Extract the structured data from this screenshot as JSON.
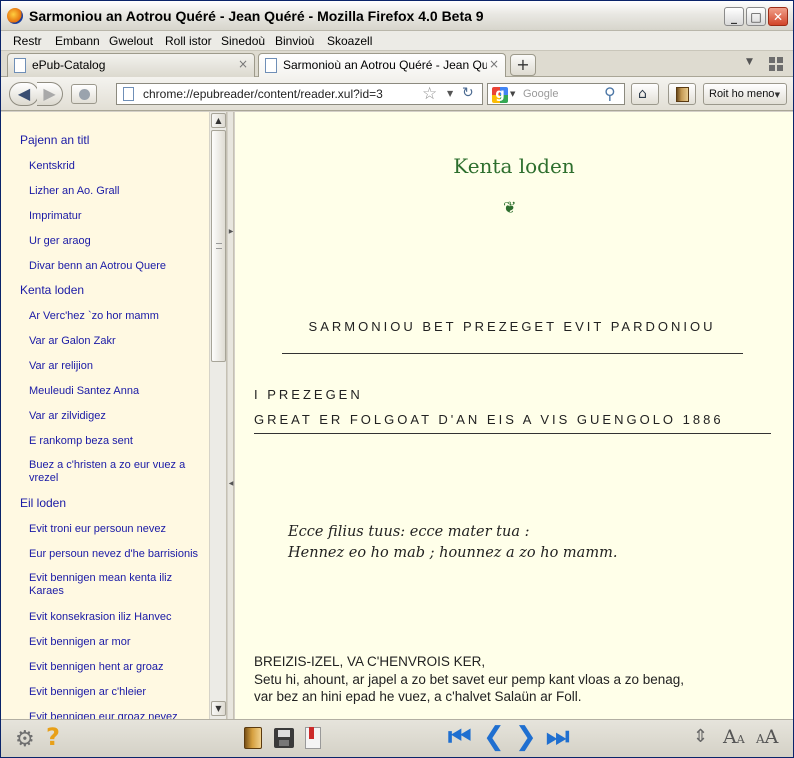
{
  "window": {
    "title": "Sarmoniou an Aotrou Quéré - Jean Quéré - Mozilla Firefox 4.0 Beta 9",
    "minimize": "_",
    "maximize": "□",
    "close": "✕"
  },
  "menu": [
    "Restr",
    "Embann",
    "Gwelout",
    "Roll istor",
    "Sinedoù",
    "Binvioù",
    "Skoazell"
  ],
  "tabs": [
    {
      "label": "ePub-Catalog",
      "close": "×"
    },
    {
      "label": "Sarmonioù an Aotrou Quéré - Jean Quéré",
      "close": "×"
    }
  ],
  "newtab": "+",
  "tablist": "▼",
  "nav": {
    "back": "◀",
    "forward": "▶",
    "url": "chrome://epubreader/content/reader.xul?id=3",
    "star": "☆",
    "url_dropdown": "▼",
    "reload": "↻",
    "search_engine_dropdown": "▼",
    "search_placeholder": "Google",
    "search_icon": "⚲",
    "home": "⌂",
    "reader_mode": "Roit ho meno",
    "reader_mode_dropdown": "▼"
  },
  "toc": [
    {
      "label": "Pajenn an titl",
      "level": 1
    },
    {
      "label": "Kentskrid",
      "level": 2
    },
    {
      "label": "Lizher an Ao. Grall",
      "level": 2
    },
    {
      "label": "Imprimatur",
      "level": 2
    },
    {
      "label": "Ur ger araog",
      "level": 2
    },
    {
      "label": "Divar benn an Aotrou Quere",
      "level": 2
    },
    {
      "label": "Kenta loden",
      "level": 1
    },
    {
      "label": "Ar Verc'hez `zo hor mamm",
      "level": 2
    },
    {
      "label": "Var ar Galon Zakr",
      "level": 2
    },
    {
      "label": "Var ar relijion",
      "level": 2
    },
    {
      "label": "Meuleudi Santez Anna",
      "level": 2
    },
    {
      "label": "Var ar zilvidigez",
      "level": 2
    },
    {
      "label": "E rankomp beza sent",
      "level": 2
    },
    {
      "label": "Buez a c'hristen a zo eur vuez a vrezel",
      "level": 2
    },
    {
      "label": "Eil loden",
      "level": 1
    },
    {
      "label": "Evit troni eur persoun nevez",
      "level": 2
    },
    {
      "label": "Eur persoun nevez d'he barrisionis",
      "level": 2
    },
    {
      "label": "Evit bennigen mean kenta iliz Karaes",
      "level": 2
    },
    {
      "label": "Evit konsekrasion iliz Hanvec",
      "level": 2
    },
    {
      "label": "Evit bennigen ar mor",
      "level": 2
    },
    {
      "label": "Evit bennigen hent ar groaz",
      "level": 2
    },
    {
      "label": "Evit bennigen ar c'hleier",
      "level": 2
    },
    {
      "label": "Evit bennigen eur groaz nevez",
      "level": 2
    }
  ],
  "scroll": {
    "up": "▲",
    "down": "▼"
  },
  "splitter": {
    "left": "◀",
    "right": "▶"
  },
  "reader": {
    "chapter_title": "Kenta loden",
    "ornament": "❦",
    "sermon_heading": "SARMONIOU BET PREZEGET EVIT PARDONIOU",
    "sermon_number": "I PREZEGEN",
    "sermon_place": "GREAT ER FOLGOAT D'AN EIS A VIS GUENGOLO 1886",
    "quote_line_1": "Ecce filius tuus: ecce mater tua :",
    "quote_line_2": "Hennez eo ho mab ; hounnez a zo ho mamm.",
    "body_line_1": "BREIZIS-IZEL, VA C'HENVROIS KER,",
    "body_line_2": "Setu hi, ahount, ar japel a zo bet savet eur pemp kant vloas a zo benag,",
    "body_line_3": "var bez an hini epad he vuez, a c'halvet Salaün ar Foll."
  },
  "bottom": {
    "settings_icon": "⚙",
    "help_icon": "?",
    "first_page": "⏮",
    "prev_page": "❮",
    "next_page": "❯",
    "last_page": "⏭",
    "line_spacing": "⇕",
    "font_smaller_big": "A",
    "font_smaller_small": "A",
    "font_larger_big": "A",
    "font_larger_small": "A"
  }
}
